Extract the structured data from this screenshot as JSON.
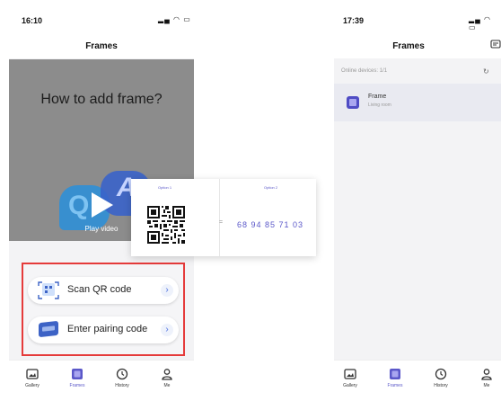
{
  "left_screen": {
    "time": "16:10",
    "title": "Frames",
    "video": {
      "heading": "How to add frame?",
      "play_label": "Play video",
      "q_glyph": "Q",
      "a_glyph": "A"
    },
    "actions": [
      {
        "label": "Scan QR code"
      },
      {
        "label": "Enter pairing code"
      }
    ]
  },
  "overlay": {
    "option1": "Option 1",
    "option2": "Option 2",
    "pairing_code": "68 94 85 71 03"
  },
  "right_screen": {
    "time": "17:39",
    "title": "Frames",
    "online_devices": "Online devices: 1/1",
    "frame": {
      "name": "Frame",
      "room": "Living room"
    }
  },
  "tabs": [
    {
      "label": "Gallery",
      "icon": "gallery-icon"
    },
    {
      "label": "Frames",
      "icon": "frames-icon",
      "active": true
    },
    {
      "label": "History",
      "icon": "history-icon"
    },
    {
      "label": "Me",
      "icon": "profile-icon"
    }
  ],
  "colors": {
    "accent": "#5b58c9",
    "highlight_border": "#e53b3b",
    "video_bg": "#8c8c8c"
  }
}
